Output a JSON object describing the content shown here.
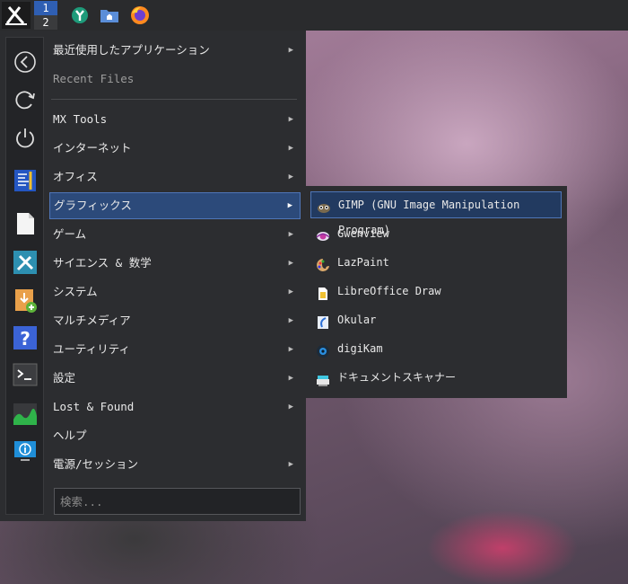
{
  "taskbar": {
    "workspaces": [
      "1",
      "2"
    ],
    "launchers": [
      {
        "name": "mx-tweak-icon"
      },
      {
        "name": "home-folder-icon"
      },
      {
        "name": "firefox-icon"
      }
    ]
  },
  "menu": {
    "sidebar_icons": [
      "back-icon",
      "refresh-icon",
      "power-icon",
      "editor-icon",
      "document-icon",
      "tools-icon",
      "installer-icon",
      "help-icon",
      "terminal-icon",
      "system-monitor-icon",
      "info-icon"
    ],
    "recent_apps": "最近使用したアプリケーション",
    "recent_files": "Recent Files",
    "categories": [
      {
        "label": "MX Tools",
        "submenu": true
      },
      {
        "label": "インターネット",
        "submenu": true
      },
      {
        "label": "オフィス",
        "submenu": true
      },
      {
        "label": "グラフィックス",
        "submenu": true,
        "active": true
      },
      {
        "label": "ゲーム",
        "submenu": true
      },
      {
        "label": "サイエンス & 数学",
        "submenu": true
      },
      {
        "label": "システム",
        "submenu": true
      },
      {
        "label": "マルチメディア",
        "submenu": true
      },
      {
        "label": "ユーティリティ",
        "submenu": true
      },
      {
        "label": "設定",
        "submenu": true
      },
      {
        "label": "Lost & Found",
        "submenu": true
      },
      {
        "label": "ヘルプ",
        "submenu": false
      },
      {
        "label": "電源/セッション",
        "submenu": true
      }
    ],
    "search_placeholder": "検索..."
  },
  "submenu": {
    "items": [
      {
        "label": "GIMP (GNU Image Manipulation Program)",
        "icon": "gimp-icon",
        "active": true
      },
      {
        "label": "Gwenview",
        "icon": "gwenview-icon"
      },
      {
        "label": "LazPaint",
        "icon": "lazpaint-icon"
      },
      {
        "label": "LibreOffice Draw",
        "icon": "libreoffice-draw-icon"
      },
      {
        "label": "Okular",
        "icon": "okular-icon"
      },
      {
        "label": "digiKam",
        "icon": "digikam-icon"
      },
      {
        "label": "ドキュメントスキャナー",
        "icon": "scanner-icon"
      }
    ]
  },
  "colors": {
    "accent": "#2f5fb3",
    "menu_bg": "#2c2d30",
    "taskbar_bg": "#2a2b2d",
    "highlight_border": "#4f76b8"
  }
}
